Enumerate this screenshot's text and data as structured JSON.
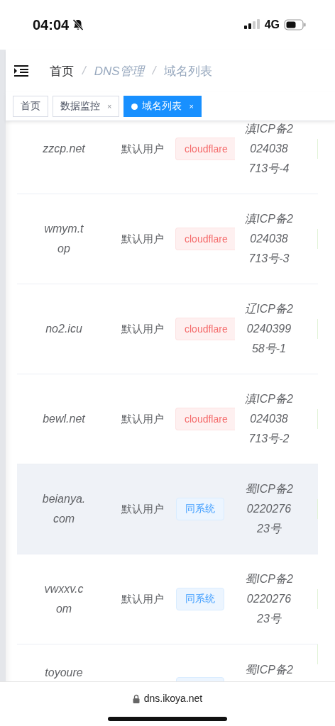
{
  "status_bar": {
    "time": "04:04",
    "network": "4G"
  },
  "header": {
    "breadcrumb": [
      {
        "label": "首页",
        "kind": "link"
      },
      {
        "label": "/",
        "kind": "separator"
      },
      {
        "label": "DNS管理",
        "kind": "muted"
      },
      {
        "label": "/",
        "kind": "separator"
      },
      {
        "label": "域名列表",
        "kind": "muted"
      }
    ]
  },
  "tabs": [
    {
      "label": "首页",
      "selected": false,
      "closable": false
    },
    {
      "label": "数据监控",
      "selected": false,
      "closable": true,
      "close": "×"
    },
    {
      "label": "域名列表",
      "selected": true,
      "closable": true,
      "close": "×"
    }
  ],
  "table": {
    "rows": [
      {
        "domain": "zzcp.net",
        "user": "默认用户",
        "tag": {
          "label": "cloudflare",
          "kind": "danger"
        },
        "icp": "滇ICP备2\n024038\n713号-4",
        "highlighted": false
      },
      {
        "domain": "wmym.t\nop",
        "user": "默认用户",
        "tag": {
          "label": "cloudflare",
          "kind": "danger"
        },
        "icp": "滇ICP备2\n024038\n713号-3",
        "highlighted": false
      },
      {
        "domain": "no2.icu",
        "user": "默认用户",
        "tag": {
          "label": "cloudflare",
          "kind": "danger"
        },
        "icp": "辽ICP备2\n0240399\n58号-1",
        "highlighted": false
      },
      {
        "domain": "bewl.net",
        "user": "默认用户",
        "tag": {
          "label": "cloudflare",
          "kind": "danger"
        },
        "icp": "滇ICP备2\n024038\n713号-2",
        "highlighted": false
      },
      {
        "domain": "beianya.\ncom",
        "user": "默认用户",
        "tag": {
          "label": "同系统",
          "kind": "primary"
        },
        "icp": "蜀ICP备2\n0220276\n23号",
        "highlighted": true
      },
      {
        "domain": "vwxxv.c\nom",
        "user": "默认用户",
        "tag": {
          "label": "同系统",
          "kind": "primary"
        },
        "icp": "蜀ICP备2\n0220276\n23号",
        "highlighted": false
      },
      {
        "domain": "toyoure",
        "tag": {
          "kind": "primary"
        },
        "icp": "蜀ICP备2",
        "highlighted": false
      }
    ]
  },
  "browser_bar": {
    "url": "dns.ikoya.net"
  }
}
